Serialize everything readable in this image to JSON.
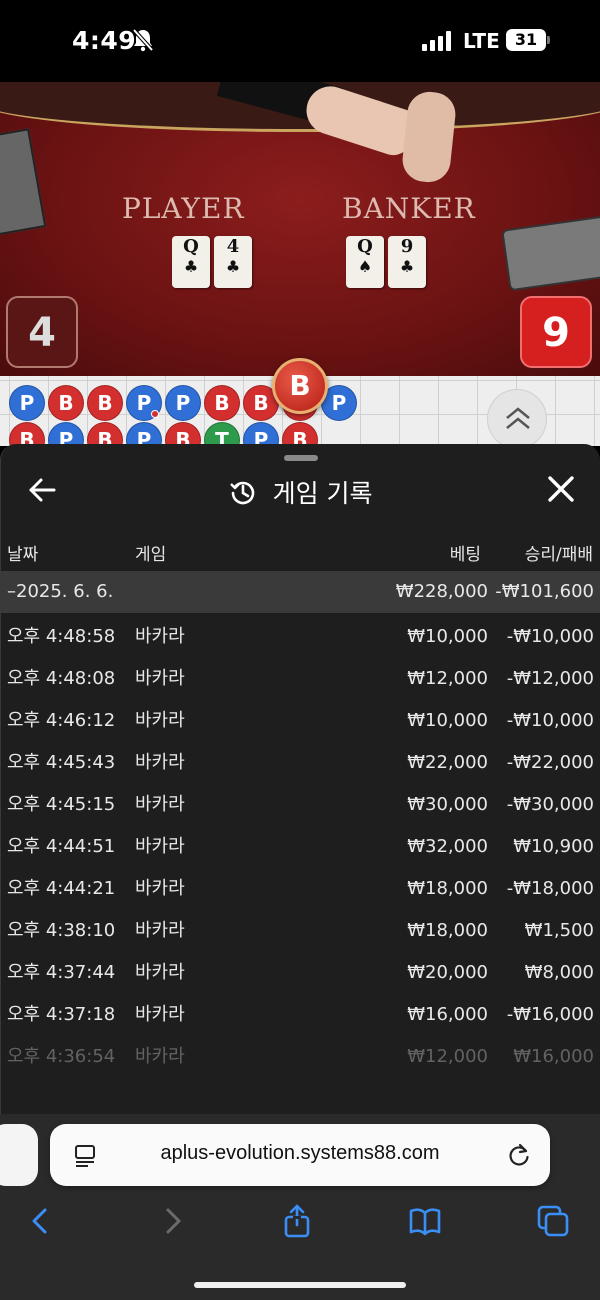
{
  "status_bar": {
    "time": "4:49",
    "network": "LTE",
    "battery": "31"
  },
  "table": {
    "player_label": "PLAYER",
    "banker_label": "BANKER",
    "player_cards": [
      {
        "rank": "Q",
        "suit": "♣"
      },
      {
        "rank": "4",
        "suit": "♣"
      }
    ],
    "banker_cards": [
      {
        "rank": "Q",
        "suit": "♠"
      },
      {
        "rank": "9",
        "suit": "♣"
      }
    ],
    "player_score": "4",
    "banker_score": "9",
    "last_result": "B"
  },
  "road_map": {
    "row1": [
      "P",
      "B",
      "B",
      "P",
      "P",
      "B",
      "B",
      "B",
      "P"
    ],
    "row2": [
      "B",
      "P",
      "B",
      "P",
      "B",
      "T",
      "P",
      "B"
    ]
  },
  "history": {
    "title": "게임 기록",
    "columns": {
      "date": "날짜",
      "game": "게임",
      "bet": "베팅",
      "result": "승리/패배"
    },
    "summary": {
      "date": "–2025. 6. 6.",
      "bet": "₩228,000",
      "result": "-₩101,600"
    },
    "rows": [
      {
        "time": "오후 4:48:58",
        "game": "바카라",
        "bet": "₩10,000",
        "result": "-₩10,000"
      },
      {
        "time": "오후 4:48:08",
        "game": "바카라",
        "bet": "₩12,000",
        "result": "-₩12,000"
      },
      {
        "time": "오후 4:46:12",
        "game": "바카라",
        "bet": "₩10,000",
        "result": "-₩10,000"
      },
      {
        "time": "오후 4:45:43",
        "game": "바카라",
        "bet": "₩22,000",
        "result": "-₩22,000"
      },
      {
        "time": "오후 4:45:15",
        "game": "바카라",
        "bet": "₩30,000",
        "result": "-₩30,000"
      },
      {
        "time": "오후 4:44:51",
        "game": "바카라",
        "bet": "₩32,000",
        "result": "₩10,900"
      },
      {
        "time": "오후 4:44:21",
        "game": "바카라",
        "bet": "₩18,000",
        "result": "-₩18,000"
      },
      {
        "time": "오후 4:38:10",
        "game": "바카라",
        "bet": "₩18,000",
        "result": "₩1,500"
      },
      {
        "time": "오후 4:37:44",
        "game": "바카라",
        "bet": "₩20,000",
        "result": "₩8,000"
      },
      {
        "time": "오후 4:37:18",
        "game": "바카라",
        "bet": "₩16,000",
        "result": "-₩16,000"
      },
      {
        "time": "오후 4:36:54",
        "game": "바카라",
        "bet": "₩12,000",
        "result": "₩16,000"
      }
    ]
  },
  "browser": {
    "url": "aplus-evolution.systems88.com"
  },
  "icons": {
    "back": "back-arrow-icon",
    "close": "close-icon",
    "history": "history-clock-icon",
    "reload": "reload-icon",
    "share": "share-icon",
    "bookmarks": "bookmarks-icon",
    "tabs": "tabs-icon"
  },
  "colors": {
    "player": "#2f6fd6",
    "banker": "#d42f2f",
    "tie": "#2e9a4b",
    "accent_blue": "#3a8ef6"
  }
}
